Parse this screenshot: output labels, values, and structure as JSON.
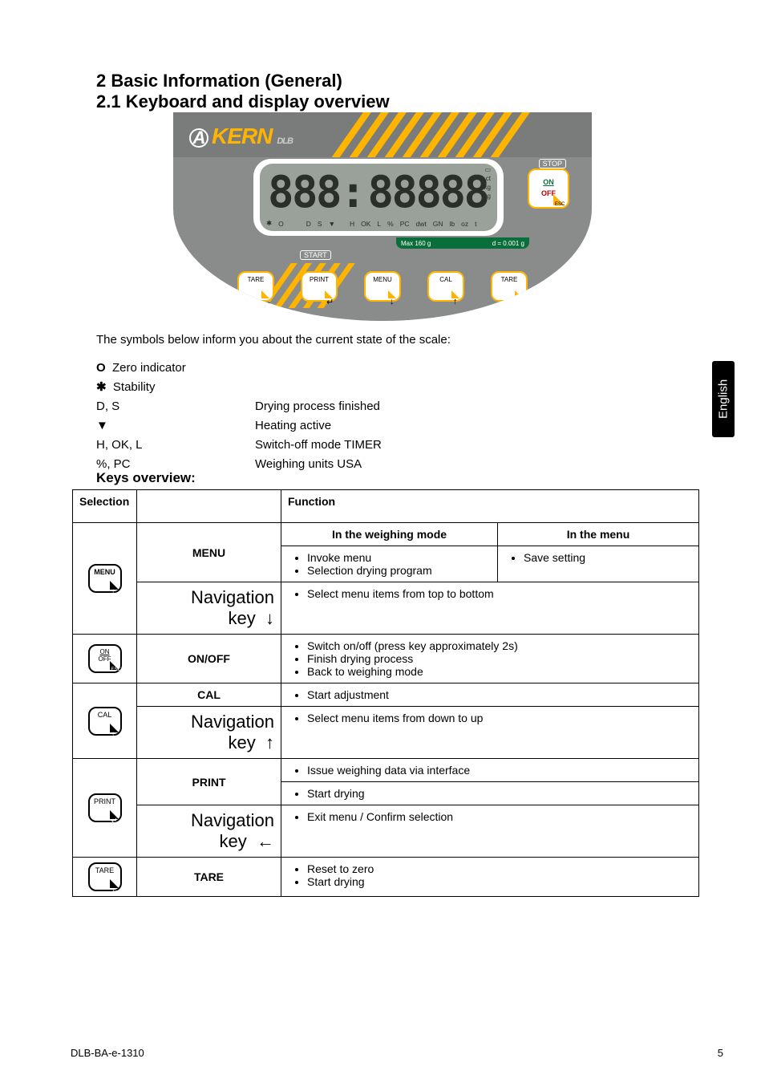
{
  "titles": {
    "page": "2 Basic Information (General)",
    "section": "2.1 Keyboard and display overview",
    "keys_overview": "Keys overview:"
  },
  "intro": "The symbols below inform you about the current state of the scale:",
  "symbols": {
    "zero": {
      "mark": "O",
      "label": "Zero indicator"
    },
    "stable": {
      "mark": "✱",
      "label": "Stability"
    },
    "ds": {
      "mark": "D, S",
      "label": "Drying process finished"
    },
    "heat": {
      "mark": "▼",
      "label": "Heating active"
    },
    "timer": {
      "mark": "H, OK, L",
      "label": "Switch-off mode TIMER"
    },
    "usa": {
      "mark": "%, PC",
      "label": "Weighing units USA"
    }
  },
  "tab_label": "English",
  "footer": {
    "left": "DLB-BA-e-1310",
    "right": "5"
  },
  "table": {
    "headers": {
      "selection": "Selection",
      "function": "Function"
    },
    "weigh_col": "In the weighing mode",
    "menu_col": "In the menu",
    "menu": {
      "name": "MENU",
      "weigh_items": [
        "Invoke menu",
        "Selection drying program"
      ],
      "menu_items": [
        "Save setting"
      ],
      "nav_name": "Navigation key",
      "nav_arrow": "↓",
      "nav_desc": "Select menu items from top to bottom"
    },
    "onoff": {
      "name": "ON/OFF",
      "items": [
        "Switch on/off (press key approximately 2s)",
        "Finish drying process",
        "Back to weighing mode"
      ]
    },
    "cal": {
      "name": "CAL",
      "item": "Start adjustment",
      "nav_name": "Navigation key",
      "nav_arrow": "↑",
      "nav_desc": "Select menu items from down to up"
    },
    "print": {
      "name": "PRINT",
      "item1": "Issue weighing data via interface",
      "item2": "Start drying",
      "nav_name": "Navigation key",
      "nav_arrow": "←",
      "nav_desc": "Exit menu / Confirm selection"
    },
    "tare": {
      "name": "TARE",
      "items": [
        "Reset to zero",
        "Start drying"
      ]
    }
  },
  "scale_panel": {
    "brand": "KERN",
    "model": "DLB",
    "lcd_bottom_markers": [
      "✱",
      "O",
      "D",
      "S",
      "▼",
      "H",
      "OK",
      "L",
      "%",
      "PC",
      "dwt",
      "GN",
      "lb",
      "oz",
      "t"
    ],
    "lcd_right_units": [
      "ct",
      "kg",
      "mg"
    ],
    "lcd_right_icon": "battery",
    "green_bar": {
      "max": "Max 160 g",
      "d": "d = 0.001 g"
    },
    "stop_label": "STOP",
    "start_label": "START",
    "on": "ON",
    "off": "OFF",
    "esc": "ESC",
    "buttons": [
      {
        "label": "TARE",
        "arrow": "←"
      },
      {
        "label": "PRINT",
        "arrow": "↵"
      },
      {
        "label": "MENU",
        "arrow": "↓"
      },
      {
        "label": "CAL",
        "arrow": "↑"
      },
      {
        "label": "TARE",
        "arrow": "←"
      }
    ]
  }
}
